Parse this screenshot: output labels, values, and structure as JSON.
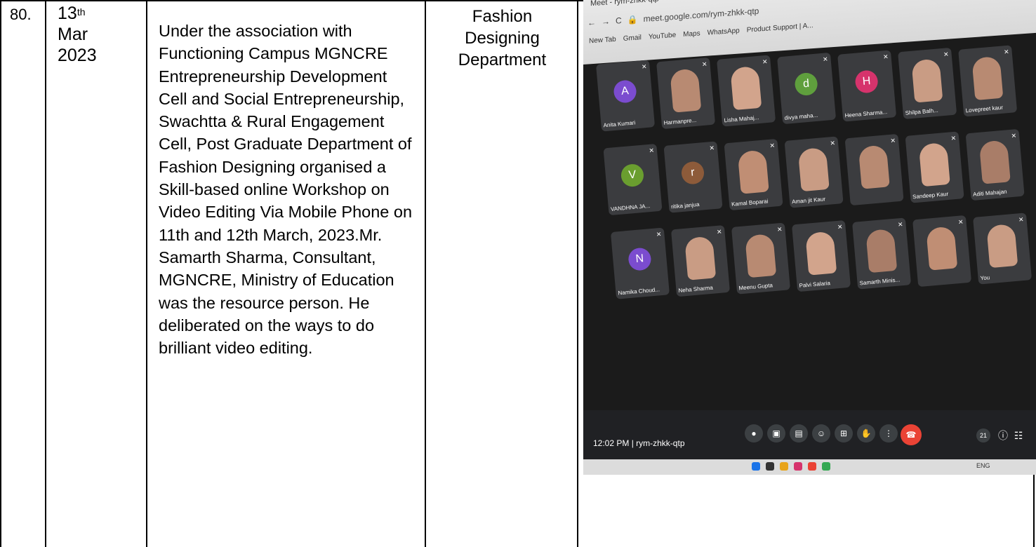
{
  "row": {
    "sno": "80.",
    "date_day": "13",
    "date_suffix": "th",
    "date_month": "Mar",
    "date_year": "2023",
    "description": "Under the association with Functioning Campus MGNCRE Entrepreneurship Development Cell and Social Entrepreneurship, Swachtta & Rural Engagement Cell, Post Graduate Department of Fashion Designing organised a Skill-based online Workshop on Video Editing Via Mobile Phone on 11th and 12th March, 2023.Mr. Samarth Sharma, Consultant, MGNCRE, Ministry of Education was the resource person. He deliberated on the ways to do brilliant video editing.",
    "department_line1": "Fashion",
    "department_line2": "Designing",
    "department_line3": "Department"
  },
  "photo": {
    "tab_title": "Meet - rym-zhkk-qtp",
    "url": "meet.google.com/rym-zhkk-qtp",
    "bookmarks": [
      "New Tab",
      "Gmail",
      "YouTube",
      "Maps",
      "WhatsApp",
      "Product Support | A..."
    ],
    "participants": [
      {
        "name": "Anita Kumari",
        "initial": "A",
        "color": "#7b4ccf"
      },
      {
        "name": "Harmanpre...",
        "initial": "",
        "color": ""
      },
      {
        "name": "Lisha Mahaj...",
        "initial": "",
        "color": ""
      },
      {
        "name": "divya maha...",
        "initial": "d",
        "color": "#5f9f3d"
      },
      {
        "name": "Heena Sharma...",
        "initial": "H",
        "color": "#d6336c"
      },
      {
        "name": "Shilpa Balh...",
        "initial": "",
        "color": ""
      },
      {
        "name": "Lovepreet kaur",
        "initial": "",
        "color": ""
      },
      {
        "name": "VANDHNA JA...",
        "initial": "V",
        "color": "#6a9e2f"
      },
      {
        "name": "ritika janjua",
        "initial": "r",
        "color": "#8d5b3a"
      },
      {
        "name": "Kamal Boparai",
        "initial": "",
        "color": ""
      },
      {
        "name": "Aman jit Kaur",
        "initial": "",
        "color": ""
      },
      {
        "name": "",
        "initial": "",
        "color": ""
      },
      {
        "name": "Sandeep Kaur",
        "initial": "",
        "color": ""
      },
      {
        "name": "Aditi Mahajan",
        "initial": "",
        "color": ""
      },
      {
        "name": "Namika Choud...",
        "initial": "N",
        "color": "#7b4ccf"
      },
      {
        "name": "Neha Sharma",
        "initial": "",
        "color": ""
      },
      {
        "name": "Meenu Gupta",
        "initial": "",
        "color": ""
      },
      {
        "name": "Palvi Salaria",
        "initial": "",
        "color": ""
      },
      {
        "name": "Samarth Minis...",
        "initial": "",
        "color": ""
      },
      {
        "name": "",
        "initial": "",
        "color": ""
      },
      {
        "name": "You",
        "initial": "",
        "color": ""
      }
    ],
    "meeting_time": "12:02 PM | rym-zhkk-qtp",
    "participant_count": "21",
    "taskbar_lang": "ENG"
  }
}
